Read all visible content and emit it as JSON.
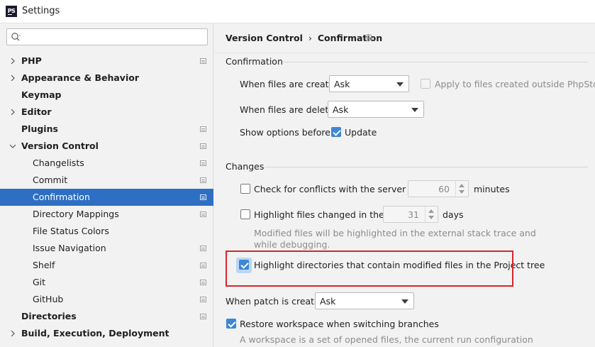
{
  "window": {
    "title": "Settings",
    "app_icon_text": "PS"
  },
  "search": {
    "placeholder": ""
  },
  "sidebar": {
    "items": [
      {
        "label": "PHP"
      },
      {
        "label": "Appearance & Behavior"
      },
      {
        "label": "Keymap"
      },
      {
        "label": "Editor"
      },
      {
        "label": "Plugins"
      },
      {
        "label": "Version Control"
      },
      {
        "label": "Changelists"
      },
      {
        "label": "Commit"
      },
      {
        "label": "Confirmation"
      },
      {
        "label": "Directory Mappings"
      },
      {
        "label": "File Status Colors"
      },
      {
        "label": "Issue Navigation"
      },
      {
        "label": "Shelf"
      },
      {
        "label": "Git"
      },
      {
        "label": "GitHub"
      },
      {
        "label": "Directories"
      },
      {
        "label": "Build, Execution, Deployment"
      }
    ]
  },
  "breadcrumb": {
    "parent": "Version Control",
    "separator": "›",
    "current": "Confirmation"
  },
  "confirmation": {
    "title": "Confirmation",
    "files_created_label": "When files are created:",
    "files_created_value": "Ask",
    "apply_outside_label": "Apply to files created outside PhpStorm",
    "files_deleted_label": "When files are deleted:",
    "files_deleted_value": "Ask",
    "show_options_label": "Show options before:",
    "update_label": "Update"
  },
  "changes": {
    "title": "Changes",
    "conflicts_label": "Check for conflicts with the server every",
    "conflicts_value": "60",
    "conflicts_unit": "minutes",
    "highlight_changed_label": "Highlight files changed in the last",
    "highlight_changed_value": "31",
    "highlight_changed_unit": "days",
    "hint_line1": "Modified files will be highlighted in the external stack trace and",
    "hint_line2": "while debugging.",
    "highlight_dirs_label": "Highlight directories that contain modified files in the Project tree"
  },
  "patch": {
    "label": "When patch is created:",
    "value": "Ask"
  },
  "workspace": {
    "restore_label": "Restore workspace when switching branches",
    "hint": "A workspace is a set of opened files, the current run configuration"
  },
  "colors": {
    "selection": "#2e6fc4",
    "accent": "#3f86d6",
    "highlight_box": "#d6262b"
  }
}
